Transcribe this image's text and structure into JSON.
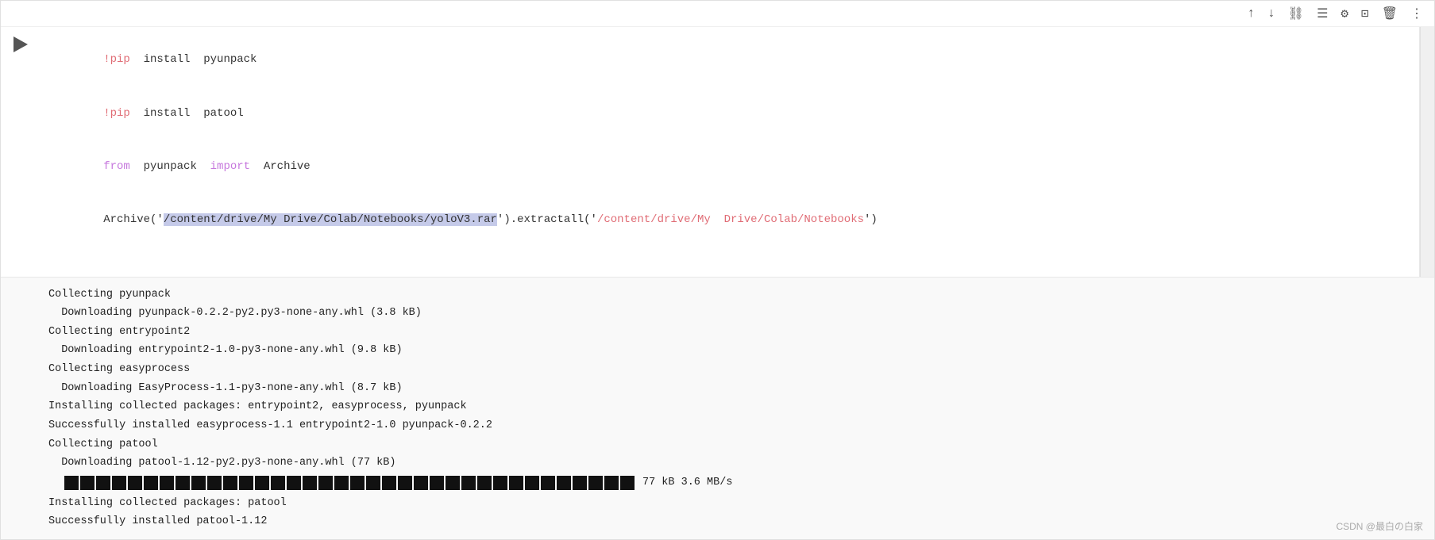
{
  "toolbar": {
    "icons": [
      "↑",
      "↓",
      "🔗",
      "☰",
      "⚙",
      "⊡",
      "🗑",
      "⋮"
    ]
  },
  "code": {
    "lines": [
      {
        "parts": [
          {
            "text": "!pip",
            "class": "kw-pip"
          },
          {
            "text": "  install  pyunpack",
            "class": "kw-normal"
          }
        ]
      },
      {
        "parts": [
          {
            "text": "!pip",
            "class": "kw-pip"
          },
          {
            "text": "  install  patool",
            "class": "kw-normal"
          }
        ]
      },
      {
        "parts": [
          {
            "text": "from",
            "class": "kw-keyword"
          },
          {
            "text": "  pyunpack  ",
            "class": "kw-normal"
          },
          {
            "text": "import",
            "class": "kw-import"
          },
          {
            "text": "  Archive",
            "class": "kw-normal"
          }
        ]
      },
      {
        "parts": [
          {
            "text": "Archive",
            "class": "kw-normal"
          },
          {
            "text": "('",
            "class": "kw-normal"
          },
          {
            "text": "/content/drive/My Drive/Colab/Notebooks/yoloV3.rar",
            "class": "kw-string"
          },
          {
            "text": "')",
            "class": "kw-normal"
          },
          {
            "text": ".extractall('",
            "class": "kw-normal"
          },
          {
            "text": "/content/drive/My Drive/Colab/Notebooks",
            "class": "kw-string"
          },
          {
            "text": "')",
            "class": "kw-normal"
          }
        ],
        "cursor_after_index": 2
      }
    ]
  },
  "output": {
    "lines": [
      "Collecting pyunpack",
      "  Downloading pyunpack-0.2.2-py2.py3-none-any.whl (3.8 kB)",
      "Collecting entrypoint2",
      "  Downloading entrypoint2-1.0-py3-none-any.whl (9.8 kB)",
      "Collecting easyprocess",
      "  Downloading EasyProcess-1.1-py3-none-any.whl (8.7 kB)",
      "Installing collected packages: entrypoint2, easyprocess, pyunpack",
      "Successfully installed easyprocess-1.1 entrypoint2-1.0 pyunpack-0.2.2",
      "Collecting patool",
      "  Downloading patool-1.12-py2.py3-none-any.whl (77 kB)"
    ],
    "progress_bar_blocks": 36,
    "progress_bar_label": "77 kB 3.6 MB/s",
    "after_progress": [
      "Installing collected packages: patool",
      "Successfully installed patool-1.12"
    ]
  },
  "watermark": "CSDN @最白の白家"
}
